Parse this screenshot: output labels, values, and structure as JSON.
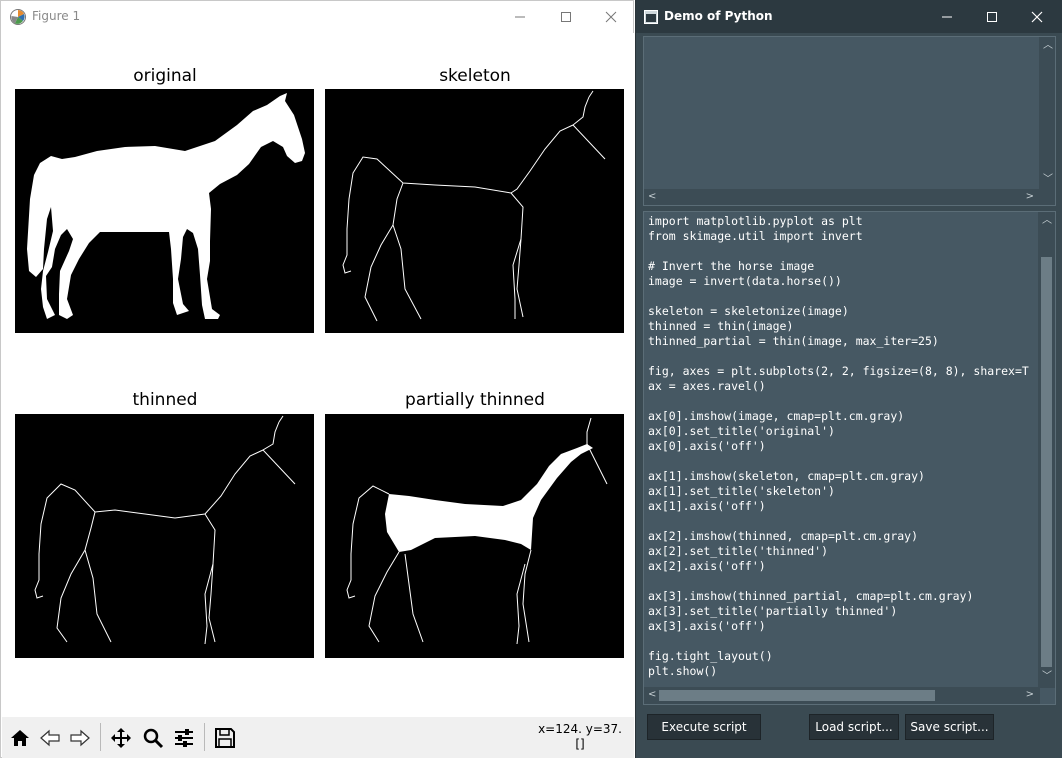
{
  "figure_window": {
    "title": "Figure 1",
    "subplots": [
      {
        "title": "original"
      },
      {
        "title": "skeleton"
      },
      {
        "title": "thinned"
      },
      {
        "title": "partially thinned"
      }
    ],
    "toolbar": {
      "buttons": [
        "home-icon",
        "back-icon",
        "forward-icon",
        "pan-icon",
        "zoom-icon",
        "configure-subplots-icon",
        "save-icon"
      ],
      "coords_line1": "x=124. y=37.",
      "coords_line2": "[]"
    }
  },
  "demo_window": {
    "title": "Demo of Python",
    "code": "import matplotlib.pyplot as plt\nfrom skimage.util import invert\n\n# Invert the horse image\nimage = invert(data.horse())\n\nskeleton = skeletonize(image)\nthinned = thin(image)\nthinned_partial = thin(image, max_iter=25)\n\nfig, axes = plt.subplots(2, 2, figsize=(8, 8), sharex=T\nax = axes.ravel()\n\nax[0].imshow(image, cmap=plt.cm.gray)\nax[0].set_title('original')\nax[0].axis('off')\n\nax[1].imshow(skeleton, cmap=plt.cm.gray)\nax[1].set_title('skeleton')\nax[1].axis('off')\n\nax[2].imshow(thinned, cmap=plt.cm.gray)\nax[2].set_title('thinned')\nax[2].axis('off')\n\nax[3].imshow(thinned_partial, cmap=plt.cm.gray)\nax[3].set_title('partially thinned')\nax[3].axis('off')\n\nfig.tight_layout()\nplt.show()",
    "buttons": {
      "execute": "Execute script",
      "load": "Load script...",
      "save": "Save script..."
    }
  },
  "colors": {
    "demo_background": "#3a4a52",
    "demo_titlebar": "#2c3940",
    "pane_background": "#465863",
    "button_background": "#283238"
  }
}
